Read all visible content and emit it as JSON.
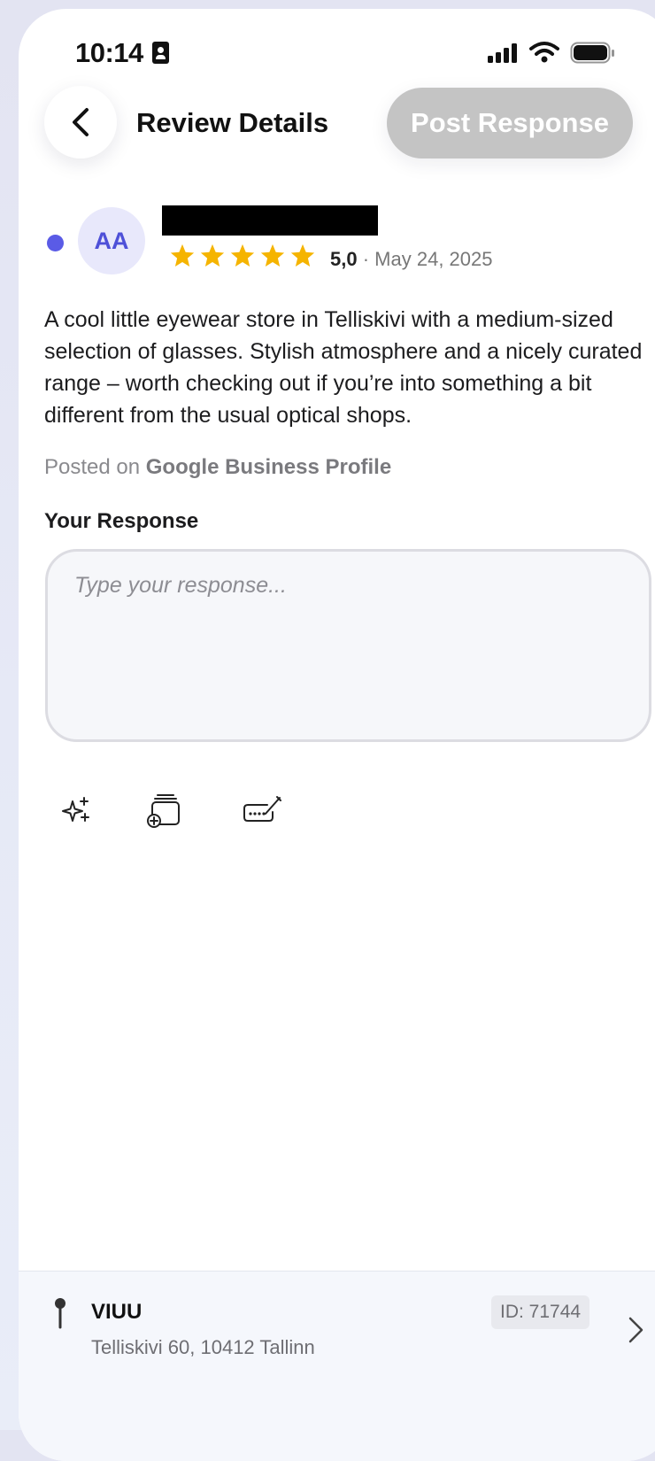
{
  "status_bar": {
    "time": "10:14",
    "icons": [
      "focus-mode-icon",
      "cellular-signal-icon",
      "wifi-icon",
      "battery-icon"
    ]
  },
  "header": {
    "back_icon": "chevron-left-icon",
    "title": "Review Details",
    "post_button_label": "Post Response",
    "post_button_state": "disabled"
  },
  "review": {
    "unread": true,
    "avatar_initials": "AA",
    "reviewer_name": "",
    "rating_stars": 5,
    "rating_value": "5,0",
    "separator": "·",
    "date": "May 24, 2025",
    "text": "A cool little eyewear store in Telliskivi with a medium-sized selection of glasses. Stylish atmosphere and a nicely curated range – worth checking out if you’re into something a bit different from the usual optical shops.",
    "posted_on_prefix": "Posted on",
    "source": "Google Business Profile"
  },
  "response": {
    "label": "Your Response",
    "placeholder": "Type your response...",
    "value": "",
    "tools": [
      "ai-sparkles-icon",
      "add-template-icon",
      "keyboard-edit-icon"
    ]
  },
  "location": {
    "name": "VIUU",
    "address": "Telliskivi 60, 10412 Tallinn",
    "id_label": "ID: 71744"
  },
  "colors": {
    "accent": "#5a5be6",
    "star": "#f5b400",
    "disabled_button": "#c4c4c4",
    "avatar_bg": "#e8e8fb"
  }
}
